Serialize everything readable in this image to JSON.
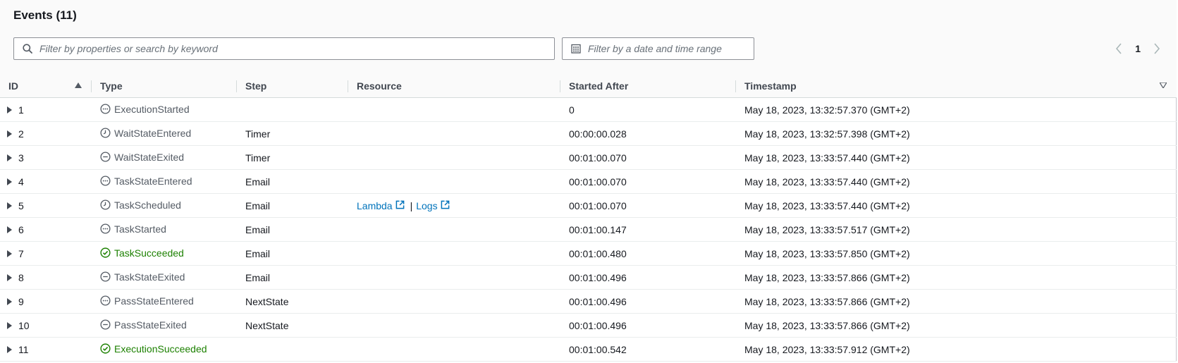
{
  "header": {
    "title": "Events (11)",
    "keyword_placeholder": "Filter by properties or search by keyword",
    "date_placeholder": "Filter by a date and time range"
  },
  "pagination": {
    "current_page": "1"
  },
  "columns": {
    "id": "ID",
    "type": "Type",
    "step": "Step",
    "resource": "Resource",
    "started_after": "Started After",
    "timestamp": "Timestamp"
  },
  "rows": [
    {
      "id": "1",
      "type": "ExecutionStarted",
      "status_icon": "dots-circle-icon",
      "step": "",
      "resource": null,
      "started_after": "0",
      "timestamp": "May 18, 2023, 13:32:57.370 (GMT+2)"
    },
    {
      "id": "2",
      "type": "WaitStateEntered",
      "status_icon": "clock-icon",
      "step": "Timer",
      "resource": null,
      "started_after": "00:00:00.028",
      "timestamp": "May 18, 2023, 13:32:57.398 (GMT+2)"
    },
    {
      "id": "3",
      "type": "WaitStateExited",
      "status_icon": "minus-circle-icon",
      "step": "Timer",
      "resource": null,
      "started_after": "00:01:00.070",
      "timestamp": "May 18, 2023, 13:33:57.440 (GMT+2)"
    },
    {
      "id": "4",
      "type": "TaskStateEntered",
      "status_icon": "dots-circle-icon",
      "step": "Email",
      "resource": null,
      "started_after": "00:01:00.070",
      "timestamp": "May 18, 2023, 13:33:57.440 (GMT+2)"
    },
    {
      "id": "5",
      "type": "TaskScheduled",
      "status_icon": "clock-icon",
      "step": "Email",
      "resource": {
        "lambda": "Lambda",
        "sep": "|",
        "logs": "Logs"
      },
      "started_after": "00:01:00.070",
      "timestamp": "May 18, 2023, 13:33:57.440 (GMT+2)"
    },
    {
      "id": "6",
      "type": "TaskStarted",
      "status_icon": "dots-circle-icon",
      "step": "Email",
      "resource": null,
      "started_after": "00:01:00.147",
      "timestamp": "May 18, 2023, 13:33:57.517 (GMT+2)"
    },
    {
      "id": "7",
      "type": "TaskSucceeded",
      "status_icon": "check-circle-icon",
      "step": "Email",
      "resource": null,
      "started_after": "00:01:00.480",
      "timestamp": "May 18, 2023, 13:33:57.850 (GMT+2)"
    },
    {
      "id": "8",
      "type": "TaskStateExited",
      "status_icon": "minus-circle-icon",
      "step": "Email",
      "resource": null,
      "started_after": "00:01:00.496",
      "timestamp": "May 18, 2023, 13:33:57.866 (GMT+2)"
    },
    {
      "id": "9",
      "type": "PassStateEntered",
      "status_icon": "dots-circle-icon",
      "step": "NextState",
      "resource": null,
      "started_after": "00:01:00.496",
      "timestamp": "May 18, 2023, 13:33:57.866 (GMT+2)"
    },
    {
      "id": "10",
      "type": "PassStateExited",
      "status_icon": "minus-circle-icon",
      "step": "NextState",
      "resource": null,
      "started_after": "00:01:00.496",
      "timestamp": "May 18, 2023, 13:33:57.866 (GMT+2)"
    },
    {
      "id": "11",
      "type": "ExecutionSucceeded",
      "status_icon": "check-circle-icon",
      "step": "",
      "resource": null,
      "started_after": "00:01:00.542",
      "timestamp": "May 18, 2023, 13:33:57.912 (GMT+2)"
    }
  ],
  "colors": {
    "neutral_status": "#545b64",
    "success_status": "#1d8102",
    "link": "#0073bb"
  }
}
